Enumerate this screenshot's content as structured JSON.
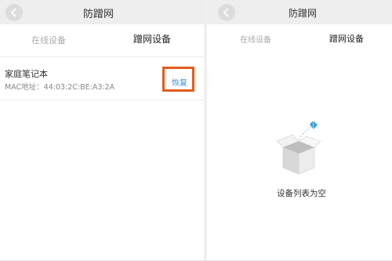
{
  "left_screen": {
    "title": "防蹭网",
    "tabs": [
      {
        "label": "在线设备",
        "active": false
      },
      {
        "label": "蹭网设备",
        "active": true
      }
    ],
    "devices": [
      {
        "name": "家庭笔记本",
        "mac": "MAC地址：44:03:2C:BE:A3:2A",
        "action_label": "恢复"
      }
    ]
  },
  "right_screen": {
    "title": "防蹭网",
    "tabs": [
      {
        "label": "在线设备",
        "active": false
      },
      {
        "label": "蹭网设备",
        "active": true
      }
    ],
    "empty_state_text": "设备列表为空"
  },
  "colors": {
    "highlight_border": "#e45c1c",
    "action_text": "#3b8fd4",
    "titlebar_bg": "#eeeeee"
  },
  "icons": {
    "back": "arrow-left-icon",
    "empty_state": "open-box-icon"
  }
}
